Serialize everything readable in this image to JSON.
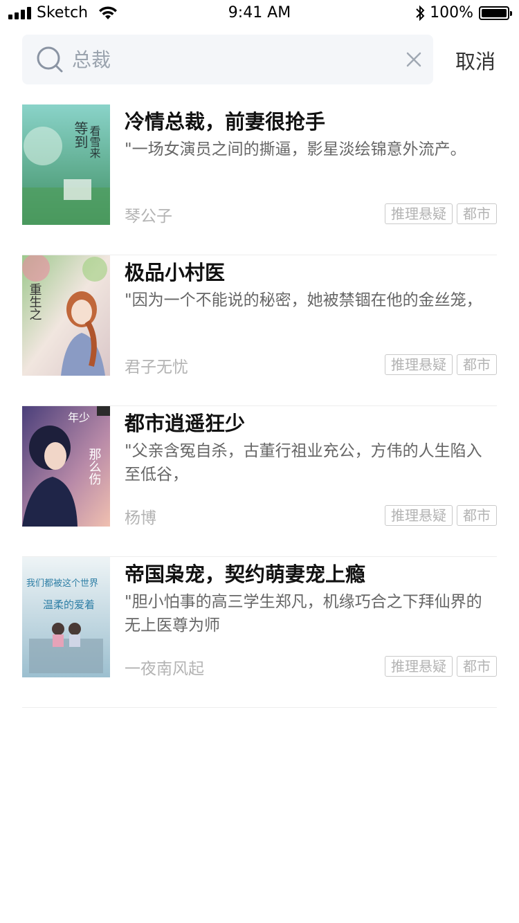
{
  "status_bar": {
    "carrier": "Sketch",
    "time": "9:41 AM",
    "battery": "100%"
  },
  "search": {
    "placeholder": "总裁",
    "cancel_label": "取消"
  },
  "books": [
    {
      "title": "冷情总裁，前妻很抢手",
      "desc": "\"一场女演员之间的撕逼，影星淡绘锦意外流产。",
      "author": "琴公子",
      "tags": [
        "推理悬疑",
        "都市"
      ]
    },
    {
      "title": "极品小村医",
      "desc": "\"因为一个不能说的秘密，她被禁锢在他的金丝笼，",
      "author": "君子无忧",
      "tags": [
        "推理悬疑",
        "都市"
      ]
    },
    {
      "title": "都市逍遥狂少",
      "desc": "\"父亲含冤自杀，古董行祖业充公，方伟的人生陷入至低谷，",
      "author": "杨博",
      "tags": [
        "推理悬疑",
        "都市"
      ]
    },
    {
      "title": "帝国枭宠，契约萌妻宠上瘾",
      "desc": "\"胆小怕事的高三学生郑凡，机缘巧合之下拜仙界的无上医尊为师",
      "author": "一夜南风起",
      "tags": [
        "推理悬疑",
        "都市"
      ]
    }
  ],
  "covers": [
    {
      "icon": "book-cover-image",
      "text": "等到黎明看雪来",
      "colors": [
        "#7cc9c0",
        "#3f8f63"
      ]
    },
    {
      "icon": "book-cover-image",
      "text": "重生之岁月如歌",
      "colors": [
        "#e9d7cf",
        "#9ec48a"
      ]
    },
    {
      "icon": "book-cover-image",
      "text": "年少那么伤",
      "colors": [
        "#5b4a8a",
        "#e3a6a0"
      ]
    },
    {
      "icon": "book-cover-image",
      "text": "我们都被这个世界温柔的爱着",
      "colors": [
        "#dde9ee",
        "#8fb6c7"
      ]
    }
  ]
}
